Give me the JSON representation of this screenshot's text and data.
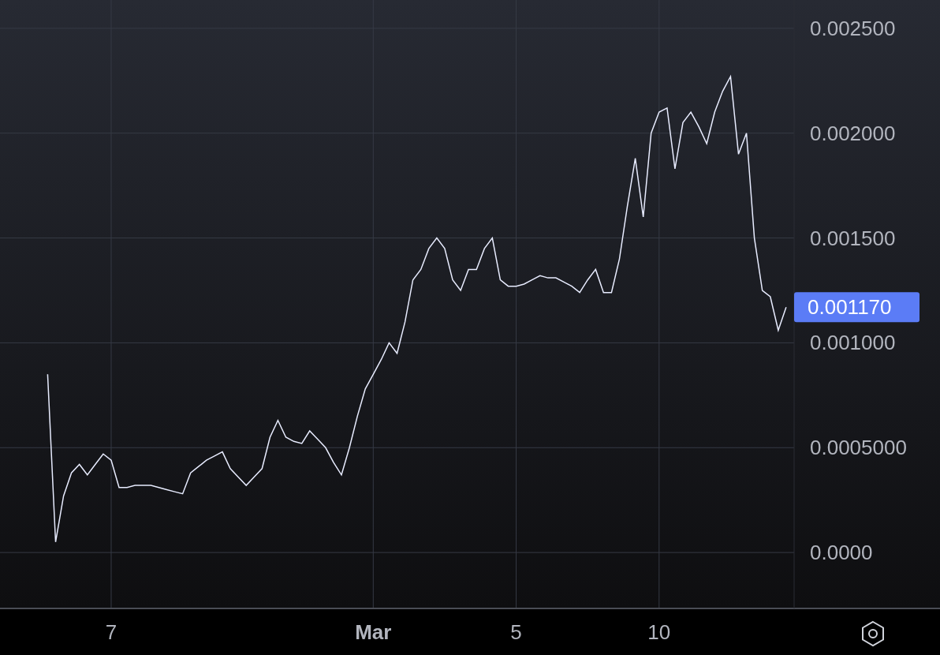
{
  "chart_data": {
    "type": "line",
    "grid": true,
    "ylim": [
      -0.000263,
      0.002635
    ],
    "categories": [
      null,
      null,
      null,
      null,
      null,
      null,
      null,
      null,
      null,
      null,
      null,
      null,
      null,
      null,
      "7",
      null,
      null,
      null,
      null,
      null,
      null,
      null,
      null,
      null,
      null,
      null,
      null,
      null,
      null,
      null,
      null,
      null,
      null,
      null,
      null,
      null,
      null,
      null,
      null,
      null,
      null,
      null,
      null,
      null,
      null,
      null,
      null,
      "Mar",
      null,
      null,
      null,
      null,
      null,
      null,
      null,
      null,
      null,
      null,
      null,
      null,
      null,
      null,
      null,
      null,
      null,
      "5",
      null,
      null,
      null,
      null,
      null,
      null,
      null,
      null,
      null,
      null,
      null,
      null,
      null,
      null,
      null,
      null,
      null,
      "10",
      null,
      null,
      null,
      null,
      null,
      null,
      null,
      null,
      null,
      null,
      null,
      null,
      null,
      null,
      null,
      null
    ],
    "yticks": [
      {
        "value": 0,
        "label": "0.0000"
      },
      {
        "value": 0.0005,
        "label": "0.0005000"
      },
      {
        "value": 0.001,
        "label": "0.001000"
      },
      {
        "value": 0.0015,
        "label": "0.001500"
      },
      {
        "value": 0.002,
        "label": "0.002000"
      },
      {
        "value": 0.0025,
        "label": "0.002500"
      }
    ],
    "series": [
      {
        "color": "#e8ecff",
        "values": [
          null,
          null,
          null,
          null,
          null,
          null,
          0.00085,
          5e-05,
          0.00027,
          0.00038,
          0.00042,
          0.00037,
          0.00042,
          0.00047,
          0.00044,
          0.00031,
          0.00031,
          0.00032,
          0.00032,
          0.00032,
          0.00031,
          0.0003,
          0.00029,
          0.00028,
          0.00038,
          0.00041,
          0.00044,
          0.00046,
          0.00048,
          0.0004,
          0.00036,
          0.00032,
          0.00036,
          0.0004,
          0.00055,
          0.00063,
          0.00055,
          0.00053,
          0.00052,
          0.00058,
          0.00054,
          0.0005,
          0.00043,
          0.00037,
          0.0005,
          0.00065,
          0.00078,
          0.00085,
          0.00092,
          0.001,
          0.00095,
          0.0011,
          0.0013,
          0.00135,
          0.00145,
          0.0015,
          0.00145,
          0.0013,
          0.00125,
          0.00135,
          0.00135,
          0.00145,
          0.0015,
          0.0013,
          0.00127,
          0.00127,
          0.00128,
          0.0013,
          0.00132,
          0.00131,
          0.00131,
          0.00129,
          0.00127,
          0.00124,
          0.0013,
          0.00135,
          0.00124,
          0.00124,
          0.0014,
          0.00165,
          0.00188,
          0.0016,
          0.002,
          0.0021,
          0.00212,
          0.00183,
          0.00205,
          0.0021,
          0.00203,
          0.00195,
          0.0021,
          0.0022,
          0.00227,
          0.0019,
          0.002,
          0.0015,
          0.00125,
          0.00122,
          0.00106,
          0.00117
        ]
      }
    ]
  },
  "last_price": {
    "label": "0.001170"
  }
}
